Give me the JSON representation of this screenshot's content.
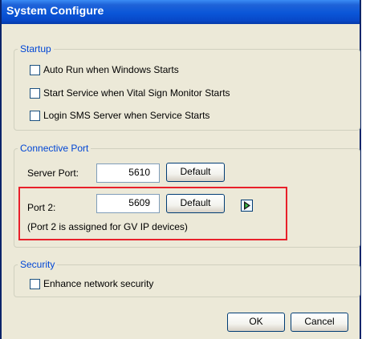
{
  "window": {
    "title": "System Configure"
  },
  "startup": {
    "legend": "Startup",
    "options": [
      {
        "label": "Auto Run when Windows Starts",
        "checked": false
      },
      {
        "label": "Start Service when Vital Sign Monitor Starts",
        "checked": false
      },
      {
        "label": "Login SMS Server when Service Starts",
        "checked": false
      }
    ]
  },
  "connective_port": {
    "legend": "Connective Port",
    "server_port": {
      "label": "Server Port:",
      "value": "5610",
      "default_label": "Default"
    },
    "port2": {
      "label": "Port 2:",
      "value": "5609",
      "default_label": "Default",
      "note": "(Port 2 is assigned for GV IP devices)"
    }
  },
  "security": {
    "legend": "Security",
    "options": [
      {
        "label": "Enhance network security",
        "checked": false
      }
    ]
  },
  "footer": {
    "ok_label": "OK",
    "cancel_label": "Cancel"
  },
  "icons": {
    "arrow": "play-arrow-icon"
  },
  "colors": {
    "legend_text": "#0046d5",
    "highlight": "#e8202a",
    "window_bg": "#ece9d8",
    "titlebar": "#0a56d8"
  }
}
